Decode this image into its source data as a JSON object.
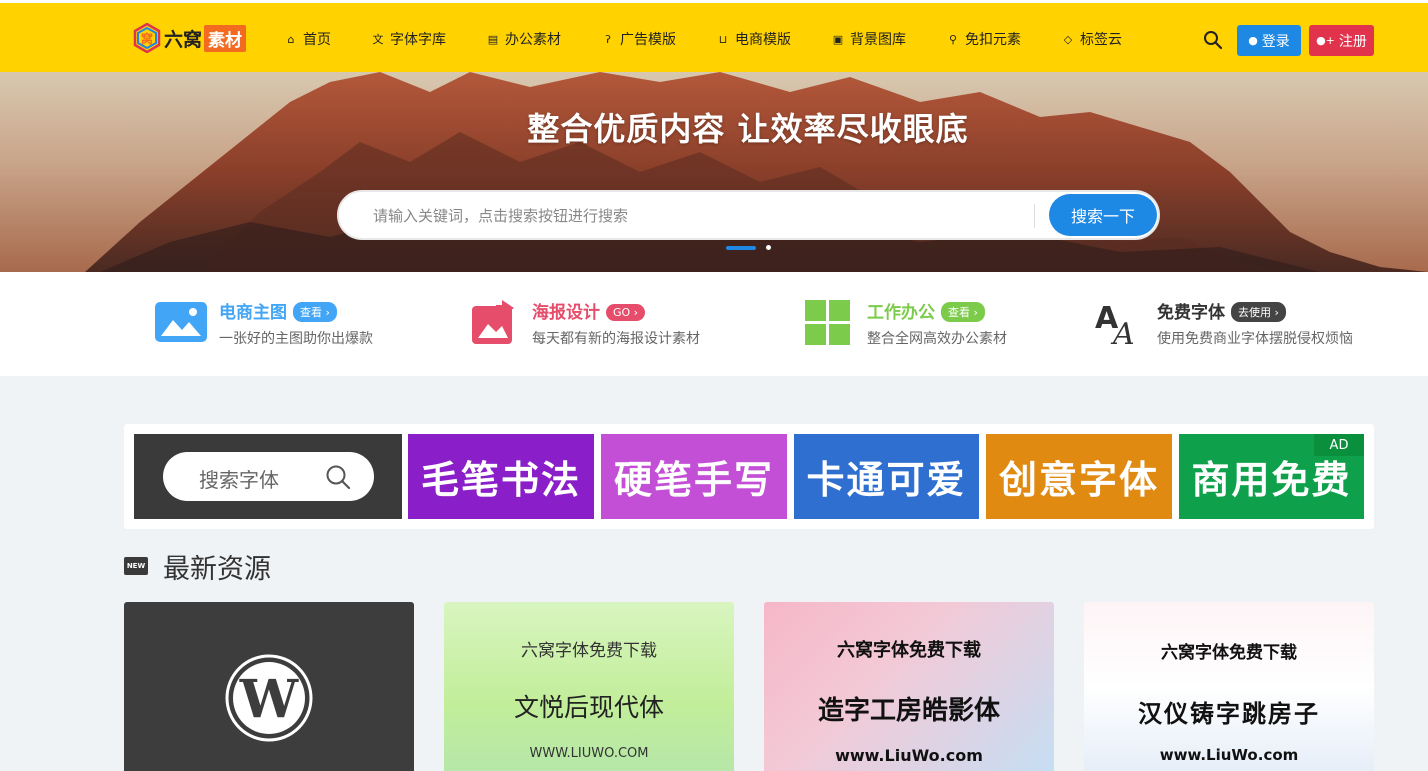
{
  "header": {
    "logo_text": "六窝",
    "logo_tag": "素材",
    "logo_mark_char": "窝",
    "nav": [
      {
        "label": "首页",
        "icon": "home-icon",
        "glyph": "⌂"
      },
      {
        "label": "字体字库",
        "icon": "translate-icon",
        "glyph": "文"
      },
      {
        "label": "办公素材",
        "icon": "document-icon",
        "glyph": "▤"
      },
      {
        "label": "广告模版",
        "icon": "ear-icon",
        "glyph": "ʔ"
      },
      {
        "label": "电商模版",
        "icon": "cart-icon",
        "glyph": "⊔"
      },
      {
        "label": "背景图库",
        "icon": "image-icon",
        "glyph": "▣"
      },
      {
        "label": "免扣元素",
        "icon": "magic-wand-icon",
        "glyph": "⚲"
      },
      {
        "label": "标签云",
        "icon": "tag-icon",
        "glyph": "◇"
      }
    ],
    "login_label": "登录",
    "register_label": "注册"
  },
  "hero": {
    "title": "整合优质内容 让效率尽收眼底",
    "search_placeholder": "请输入关键词，点击搜索按钮进行搜索",
    "search_button": "搜索一下"
  },
  "features": [
    {
      "title": "电商主图",
      "badge": "查看",
      "desc": "一张好的主图助你出爆款",
      "color": "#1e88e5",
      "badge_color": "#42a5f5",
      "icon": "image-icon"
    },
    {
      "title": "海报设计",
      "badge": "GO",
      "desc": "每天都有新的海报设计素材",
      "color": "#e54d6b",
      "badge_color": "#e54d6b",
      "icon": "poster-icon"
    },
    {
      "title": "工作办公",
      "badge": "查看",
      "desc": "整合全网高效办公素材",
      "color": "#7ccb4a",
      "badge_color": "#7ccb4a",
      "icon": "windows-grid-icon"
    },
    {
      "title": "免费字体",
      "badge": "去使用",
      "desc": "使用免费商业字体摆脱侵权烦恼",
      "color": "#333333",
      "badge_color": "#444444",
      "icon": "font-icon"
    }
  ],
  "font_banner": {
    "search_label": "搜索字体",
    "tiles": [
      {
        "label": "毛笔书法",
        "color": "#8a1ec8"
      },
      {
        "label": "硬笔手写",
        "color": "#c34fd6"
      },
      {
        "label": "卡通可爱",
        "color": "#2e6fd0"
      },
      {
        "label": "创意字体",
        "color": "#e08a12"
      },
      {
        "label": "商用免费",
        "color": "#0ea04a"
      }
    ],
    "ad_label": "AD"
  },
  "section": {
    "new_badge": "NEW",
    "title": "最新资源"
  },
  "cards": [
    {
      "type": "wordpress"
    },
    {
      "line1": "六窝字体免费下载",
      "line2": "文悦后现代体",
      "line3": "WWW.LIUWO.COM"
    },
    {
      "line1": "六窝字体免费下载",
      "line2": "造字工房皓影体",
      "line3": "www.LiuWo.com"
    },
    {
      "line1": "六窝字体免费下载",
      "line2": "汉仪铸字跳房子",
      "line3": "www.LiuWo.com"
    }
  ]
}
